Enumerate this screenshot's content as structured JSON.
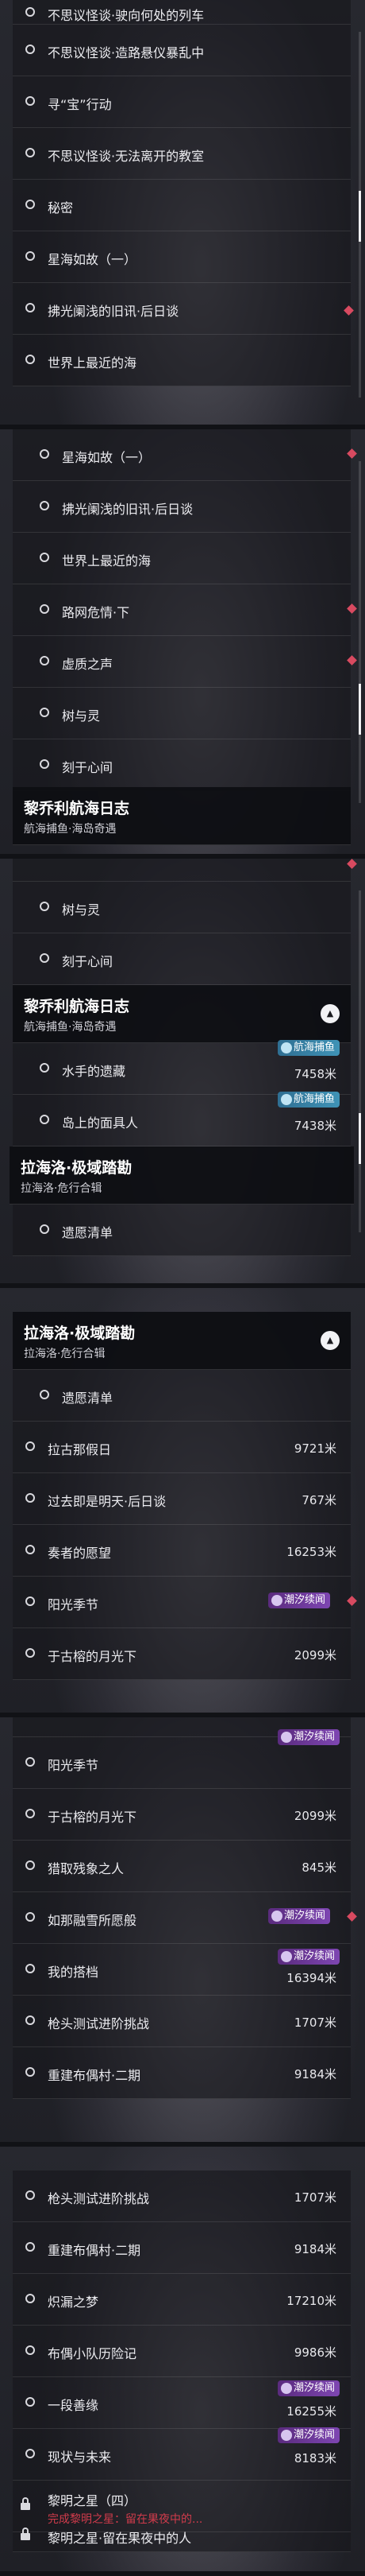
{
  "screen1": {
    "items": [
      {
        "label": "不思议怪谈·驶向何处的列车"
      },
      {
        "label": "不思议怪谈·造路悬仪暴乱中"
      },
      {
        "label": "寻“宝”行动"
      },
      {
        "label": "不思议怪谈·无法离开的教室"
      },
      {
        "label": "秘密"
      },
      {
        "label": "星海如故（一）"
      },
      {
        "label": "拂光阑浅的旧讯·后日谈"
      },
      {
        "label": "世界上最近的海"
      }
    ]
  },
  "screen2": {
    "items": [
      {
        "label": "星海如故（一）"
      },
      {
        "label": "拂光阑浅的旧讯·后日谈"
      },
      {
        "label": "世界上最近的海"
      },
      {
        "label": "路网危情·下"
      },
      {
        "label": "虚质之声"
      },
      {
        "label": "树与灵"
      },
      {
        "label": "刻于心间"
      }
    ],
    "header": {
      "title": "黎乔利航海日志",
      "subtitle": "航海捕鱼·海岛奇遇"
    }
  },
  "screen3": {
    "items_top": [
      {
        "label": "树与灵"
      },
      {
        "label": "刻于心间"
      }
    ],
    "header1": {
      "title": "黎乔利航海日志",
      "subtitle": "航海捕鱼·海岛奇遇"
    },
    "items_mid": [
      {
        "label": "水手的遗藏",
        "distance": "7458米",
        "badge": "航海捕鱼"
      },
      {
        "label": "岛上的面具人",
        "distance": "7438米",
        "badge": "航海捕鱼"
      }
    ],
    "header2": {
      "title": "拉海洛·极域踏勘",
      "subtitle": "拉海洛·危行合辑"
    },
    "items_bottom": [
      {
        "label": "遗愿清单"
      }
    ]
  },
  "screen4": {
    "header": {
      "title": "拉海洛·极域踏勘",
      "subtitle": "拉海洛·危行合辑"
    },
    "items": [
      {
        "label": "遗愿清单"
      },
      {
        "label": "拉古那假日",
        "distance": "9721米"
      },
      {
        "label": "过去即是明天·后日谈",
        "distance": "767米"
      },
      {
        "label": "奏者的愿望",
        "distance": "16253米"
      },
      {
        "label": "阳光季节",
        "badge": "潮汐续闻"
      },
      {
        "label": "于古榕的月光下",
        "distance": "2099米"
      }
    ]
  },
  "screen5": {
    "items": [
      {
        "label": "阳光季节",
        "badge": "潮汐续闻"
      },
      {
        "label": "于古榕的月光下",
        "distance": "2099米"
      },
      {
        "label": "猎取残象之人",
        "distance": "845米"
      },
      {
        "label": "如那融雪所愿般",
        "badge": "潮汐续闻"
      },
      {
        "label": "我的搭档",
        "distance": "16394米",
        "badge": "潮汐续闻"
      },
      {
        "label": "枪头测试进阶挑战",
        "distance": "1707米"
      },
      {
        "label": "重建布偶村·二期",
        "distance": "9184米"
      }
    ]
  },
  "screen6": {
    "items": [
      {
        "label": "枪头测试进阶挑战",
        "distance": "1707米"
      },
      {
        "label": "重建布偶村·二期",
        "distance": "9184米"
      },
      {
        "label": "炽漏之梦",
        "distance": "17210米"
      },
      {
        "label": "布偶小队历险记",
        "distance": "9986米"
      },
      {
        "label": "一段善缘",
        "distance": "16255米",
        "badge": "潮汐续闻"
      },
      {
        "label": "现状与未来",
        "distance": "8183米",
        "badge": "潮汐续闻"
      }
    ],
    "locked": {
      "label": "黎明之星（四）",
      "requirement": "完成黎明之星：留在果夜中的..."
    },
    "partial": {
      "label": "黎明之星·留在果夜中的人"
    }
  }
}
